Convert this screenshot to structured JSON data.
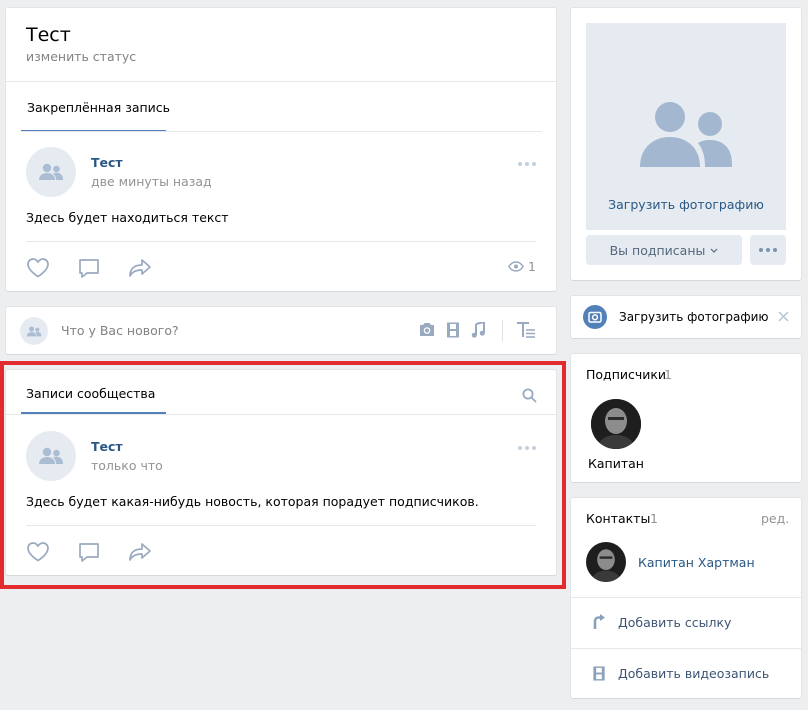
{
  "profile": {
    "name": "Тест",
    "status_placeholder": "изменить статус"
  },
  "pinned": {
    "tab_label": "Закреплённая запись",
    "author": "Тест",
    "time": "две минуты назад",
    "text": "Здесь будет находиться текст",
    "views": "1"
  },
  "composer": {
    "placeholder": "Что у Вас нового?"
  },
  "community": {
    "tab_label": "Записи сообщества",
    "author": "Тест",
    "time": "только что",
    "text": "Здесь будет какая-нибудь новость, которая порадует подписчиков."
  },
  "sidebar": {
    "upload_photo_label": "Загрузить фотографию",
    "subscribed_label": "Вы подписаны",
    "notice_upload_label": "Загрузить фотографию",
    "followers": {
      "title": "Подписчики",
      "count": "1",
      "member_name": "Капитан"
    },
    "contacts": {
      "title": "Контакты",
      "count": "1",
      "edit_label": "ред.",
      "contact_name": "Капитан Хартман"
    },
    "add_link_label": "Добавить ссылку",
    "add_video_label": "Добавить видеозапись"
  },
  "colors": {
    "accent": "#5181b8",
    "link": "#2a5885",
    "highlight_border": "#e32a2f",
    "background": "#edeef0"
  }
}
